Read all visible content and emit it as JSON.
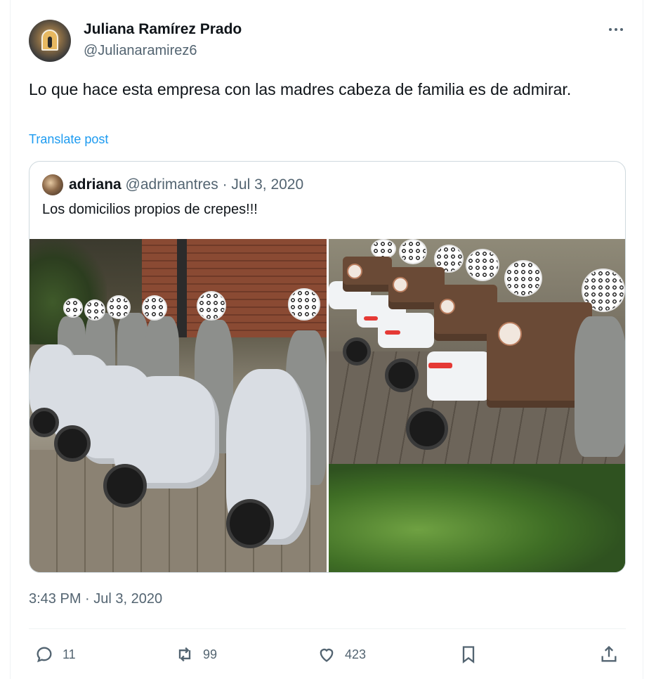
{
  "post": {
    "author_name": "Juliana Ramírez Prado",
    "author_handle": "@Julianaramirez6",
    "text": "Lo que hace esta empresa con las madres cabeza de familia es de admirar.",
    "translate_label": "Translate post",
    "timestamp": "3:43 PM · Jul 3, 2020"
  },
  "quote": {
    "name": "adriana",
    "handle": "@adrimantres",
    "separator": " · ",
    "date": "Jul 3, 2020",
    "text": "Los domicilios propios de crepes!!!"
  },
  "actions": {
    "replies": "11",
    "reposts": "99",
    "likes": "423"
  },
  "icons": [
    "more-icon",
    "reply-icon",
    "repost-icon",
    "like-icon",
    "bookmark-icon",
    "share-icon"
  ],
  "colors": {
    "link": "#1d9bf0",
    "secondary_text": "#536471",
    "border": "#cfd9de"
  }
}
